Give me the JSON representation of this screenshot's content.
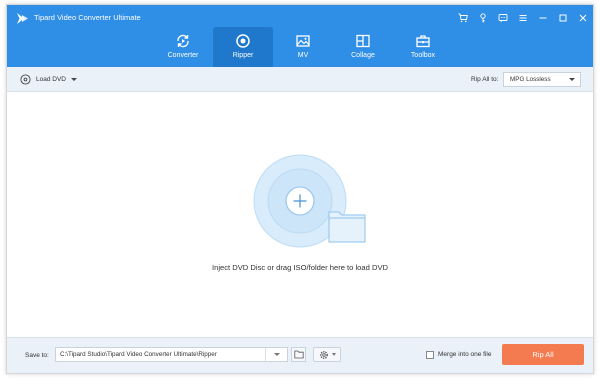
{
  "app": {
    "title": "Tipard Video Converter Ultimate"
  },
  "titlebar_icons": [
    "cart-icon",
    "key-icon",
    "feedback-icon",
    "menu-icon",
    "minimize-icon",
    "maximize-icon",
    "close-icon"
  ],
  "nav": {
    "tabs": [
      {
        "label": "Converter",
        "icon": "converter-icon",
        "active": false
      },
      {
        "label": "Ripper",
        "icon": "ripper-icon",
        "active": true
      },
      {
        "label": "MV",
        "icon": "mv-icon",
        "active": false
      },
      {
        "label": "Collage",
        "icon": "collage-icon",
        "active": false
      },
      {
        "label": "Toolbox",
        "icon": "toolbox-icon",
        "active": false
      }
    ]
  },
  "toolbar": {
    "load_dvd_label": "Load DVD",
    "rip_all_to_label": "Rip All to:",
    "format_value": "MPG Lossless"
  },
  "drop_area": {
    "hint": "Inject DVD Disc or drag ISO/folder here to load DVD"
  },
  "bottom": {
    "save_to_label": "Save to:",
    "save_path": "C:\\Tipard Studio\\Tipard Video Converter Ultimate\\Ripper",
    "merge_label": "Merge into one file",
    "merge_checked": false,
    "rip_all_label": "Rip All"
  },
  "colors": {
    "header": "#2f8ee6",
    "active_tab": "#1f78cc",
    "toolbar_bg": "#eaf1f9",
    "rip_button": "#f47a4f"
  }
}
